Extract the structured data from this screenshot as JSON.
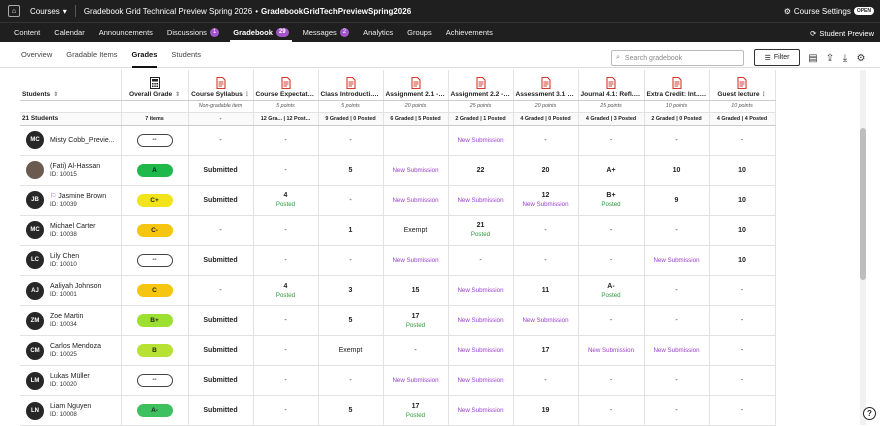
{
  "topbar": {
    "courses_label": "Courses",
    "course_title": "Gradebook Grid Technical Preview Spring 2026",
    "bullet": "•",
    "course_code": "GradebookGridTechPreviewSpring2026",
    "settings_label": "Course Settings",
    "open_badge": "OPEN"
  },
  "nav": {
    "items": [
      {
        "label": "Content"
      },
      {
        "label": "Calendar"
      },
      {
        "label": "Announcements"
      },
      {
        "label": "Discussions",
        "badge": "1"
      },
      {
        "label": "Gradebook",
        "badge": "29"
      },
      {
        "label": "Messages",
        "badge": "2"
      },
      {
        "label": "Analytics"
      },
      {
        "label": "Groups"
      },
      {
        "label": "Achievements"
      }
    ],
    "student_preview": "Student Preview"
  },
  "subnav": {
    "items": [
      "Overview",
      "Gradable Items",
      "Grades",
      "Students"
    ],
    "search_placeholder": "Search gradebook",
    "filter_label": "Filter"
  },
  "grid": {
    "students_header": "Students",
    "overall_header": "Overall Grade",
    "columns": [
      {
        "title": "Course Syllabus",
        "points": "Non-gradable item",
        "summary": "-"
      },
      {
        "title": "Course Expectat...",
        "points": "5 points",
        "summary": "12 Gra... | 12 Post..."
      },
      {
        "title": "Class Introducti...",
        "points": "5 points",
        "summary": "9 Graded | 0 Posted"
      },
      {
        "title": "Assignment 2.1 -...",
        "points": "20 points",
        "summary": "6 Graded | 5 Posted"
      },
      {
        "title": "Assignment 2.2 -...",
        "points": "25 points",
        "summary": "2 Graded | 1 Posted"
      },
      {
        "title": "Assessment 3.1 -...",
        "points": "20 points",
        "summary": "4 Graded | 0 Posted"
      },
      {
        "title": "Journal 4.1: Refl...",
        "points": "25 points",
        "summary": "4 Graded | 3 Posted"
      },
      {
        "title": "Extra Credit: Int...",
        "points": "10 points",
        "summary": "2 Graded | 0 Posted"
      },
      {
        "title": "Guest lecture",
        "points": "10 points",
        "summary": "4 Graded | 4 Posted"
      }
    ],
    "students_count": "21 Students",
    "overall_items": "7 items",
    "rows": [
      {
        "initials": "MC",
        "name": "Misty Cobb_Previe...",
        "id": "",
        "overall": "--",
        "ov": "dash",
        "cells": [
          {
            "v": "-"
          },
          {
            "v": "-"
          },
          {
            "v": "-"
          },
          {
            "v": ""
          },
          {
            "v": "New Submission",
            "t": "ns"
          },
          {
            "v": "-"
          },
          {
            "v": "-"
          },
          {
            "v": "-"
          },
          {
            "v": "-"
          }
        ]
      },
      {
        "initials": "FA",
        "name": "(Fati) Al-Hassan",
        "id": "ID: 10015",
        "overall": "A",
        "ov": "A",
        "photo": true,
        "cells": [
          {
            "v": "Submitted",
            "t": "b"
          },
          {
            "v": "-"
          },
          {
            "v": "5",
            "t": "b"
          },
          {
            "v": "New Submission",
            "t": "ns"
          },
          {
            "v": "22",
            "t": "b"
          },
          {
            "v": "20",
            "t": "b"
          },
          {
            "v": "A+",
            "t": "b"
          },
          {
            "v": "10",
            "t": "b"
          },
          {
            "v": "10",
            "t": "b"
          }
        ]
      },
      {
        "initials": "JB",
        "name": "Jasmine Brown",
        "id": "ID: 10039",
        "overall": "C+",
        "ov": "Cp",
        "flag": true,
        "cells": [
          {
            "v": "Submitted",
            "t": "b"
          },
          {
            "v": "4",
            "t": "b",
            "p": "Posted"
          },
          {
            "v": "-"
          },
          {
            "v": "New Submission",
            "t": "ns"
          },
          {
            "v": "New Submission",
            "t": "ns"
          },
          {
            "v": "12",
            "t": "b",
            "s": "New Submission"
          },
          {
            "v": "B+",
            "t": "b",
            "p": "Posted"
          },
          {
            "v": "9",
            "t": "b"
          },
          {
            "v": "10",
            "t": "b"
          }
        ]
      },
      {
        "initials": "MC",
        "name": "Michael Carter",
        "id": "ID: 10038",
        "overall": "C-",
        "ov": "Cm",
        "cells": [
          {
            "v": "-"
          },
          {
            "v": "-"
          },
          {
            "v": "1",
            "t": "b"
          },
          {
            "v": "Exempt"
          },
          {
            "v": "21",
            "t": "b",
            "p": "Posted"
          },
          {
            "v": "-"
          },
          {
            "v": "-"
          },
          {
            "v": "-"
          },
          {
            "v": "10",
            "t": "b"
          }
        ]
      },
      {
        "initials": "LC",
        "name": "Lily Chen",
        "id": "ID: 10010",
        "overall": "--",
        "ov": "dash",
        "cells": [
          {
            "v": "Submitted",
            "t": "b"
          },
          {
            "v": "-"
          },
          {
            "v": "-"
          },
          {
            "v": "New Submission",
            "t": "ns"
          },
          {
            "v": "-"
          },
          {
            "v": "-"
          },
          {
            "v": "-"
          },
          {
            "v": "New Submission",
            "t": "ns"
          },
          {
            "v": "10",
            "t": "b"
          }
        ]
      },
      {
        "initials": "AJ",
        "name": "Aaliyah Johnson",
        "id": "ID: 10001",
        "overall": "C",
        "ov": "C",
        "cells": [
          {
            "v": "-"
          },
          {
            "v": "4",
            "t": "b",
            "p": "Posted"
          },
          {
            "v": "3",
            "t": "b"
          },
          {
            "v": "15",
            "t": "b"
          },
          {
            "v": "New Submission",
            "t": "ns"
          },
          {
            "v": "11",
            "t": "b"
          },
          {
            "v": "A-",
            "t": "b",
            "p": "Posted"
          },
          {
            "v": "-"
          },
          {
            "v": "-"
          }
        ]
      },
      {
        "initials": "ZM",
        "name": "Zoe Martin",
        "id": "ID: 10034",
        "overall": "B+",
        "ov": "Bp",
        "cells": [
          {
            "v": "Submitted",
            "t": "b"
          },
          {
            "v": "-"
          },
          {
            "v": "5",
            "t": "b"
          },
          {
            "v": "17",
            "t": "b",
            "p": "Posted"
          },
          {
            "v": "New Submission",
            "t": "ns"
          },
          {
            "v": "New Submission",
            "t": "ns"
          },
          {
            "v": "-"
          },
          {
            "v": "-"
          },
          {
            "v": "-"
          }
        ]
      },
      {
        "initials": "CM",
        "name": "Carlos Mendoza",
        "id": "ID: 10025",
        "overall": "B",
        "ov": "B",
        "cells": [
          {
            "v": "Submitted",
            "t": "b"
          },
          {
            "v": "-"
          },
          {
            "v": "Exempt"
          },
          {
            "v": "-"
          },
          {
            "v": "New Submission",
            "t": "ns"
          },
          {
            "v": "17",
            "t": "b"
          },
          {
            "v": "New Submission",
            "t": "ns"
          },
          {
            "v": "New Submission",
            "t": "ns"
          },
          {
            "v": "-"
          }
        ]
      },
      {
        "initials": "LM",
        "name": "Lukas Müller",
        "id": "ID: 10020",
        "overall": "--",
        "ov": "dash",
        "cells": [
          {
            "v": "Submitted",
            "t": "b"
          },
          {
            "v": "-"
          },
          {
            "v": "-"
          },
          {
            "v": "New Submission",
            "t": "ns"
          },
          {
            "v": "New Submission",
            "t": "ns"
          },
          {
            "v": "-"
          },
          {
            "v": "-"
          },
          {
            "v": "-"
          },
          {
            "v": "-"
          }
        ]
      },
      {
        "initials": "LN",
        "name": "Liam Nguyen",
        "id": "ID: 10008",
        "overall": "A-",
        "ov": "Am",
        "cells": [
          {
            "v": "Submitted",
            "t": "b"
          },
          {
            "v": "-"
          },
          {
            "v": "5",
            "t": "b"
          },
          {
            "v": "17",
            "t": "b",
            "p": "Posted"
          },
          {
            "v": "New Submission",
            "t": "ns"
          },
          {
            "v": "19",
            "t": "b"
          },
          {
            "v": "-"
          },
          {
            "v": "-"
          },
          {
            "v": "-"
          }
        ]
      }
    ],
    "nongradable_note": "Non-gradable item"
  }
}
